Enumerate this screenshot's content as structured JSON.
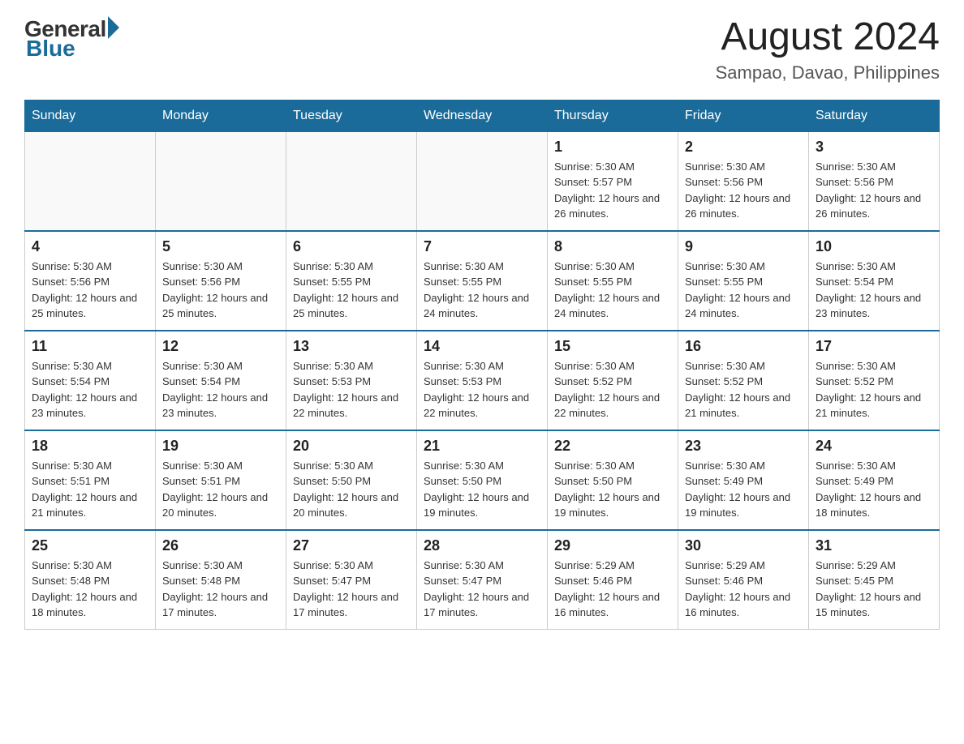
{
  "logo": {
    "general": "General",
    "blue": "Blue"
  },
  "title": {
    "month_year": "August 2024",
    "location": "Sampao, Davao, Philippines"
  },
  "days_header": [
    "Sunday",
    "Monday",
    "Tuesday",
    "Wednesday",
    "Thursday",
    "Friday",
    "Saturday"
  ],
  "weeks": [
    [
      {
        "day": "",
        "info": ""
      },
      {
        "day": "",
        "info": ""
      },
      {
        "day": "",
        "info": ""
      },
      {
        "day": "",
        "info": ""
      },
      {
        "day": "1",
        "info": "Sunrise: 5:30 AM\nSunset: 5:57 PM\nDaylight: 12 hours and 26 minutes."
      },
      {
        "day": "2",
        "info": "Sunrise: 5:30 AM\nSunset: 5:56 PM\nDaylight: 12 hours and 26 minutes."
      },
      {
        "day": "3",
        "info": "Sunrise: 5:30 AM\nSunset: 5:56 PM\nDaylight: 12 hours and 26 minutes."
      }
    ],
    [
      {
        "day": "4",
        "info": "Sunrise: 5:30 AM\nSunset: 5:56 PM\nDaylight: 12 hours and 25 minutes."
      },
      {
        "day": "5",
        "info": "Sunrise: 5:30 AM\nSunset: 5:56 PM\nDaylight: 12 hours and 25 minutes."
      },
      {
        "day": "6",
        "info": "Sunrise: 5:30 AM\nSunset: 5:55 PM\nDaylight: 12 hours and 25 minutes."
      },
      {
        "day": "7",
        "info": "Sunrise: 5:30 AM\nSunset: 5:55 PM\nDaylight: 12 hours and 24 minutes."
      },
      {
        "day": "8",
        "info": "Sunrise: 5:30 AM\nSunset: 5:55 PM\nDaylight: 12 hours and 24 minutes."
      },
      {
        "day": "9",
        "info": "Sunrise: 5:30 AM\nSunset: 5:55 PM\nDaylight: 12 hours and 24 minutes."
      },
      {
        "day": "10",
        "info": "Sunrise: 5:30 AM\nSunset: 5:54 PM\nDaylight: 12 hours and 23 minutes."
      }
    ],
    [
      {
        "day": "11",
        "info": "Sunrise: 5:30 AM\nSunset: 5:54 PM\nDaylight: 12 hours and 23 minutes."
      },
      {
        "day": "12",
        "info": "Sunrise: 5:30 AM\nSunset: 5:54 PM\nDaylight: 12 hours and 23 minutes."
      },
      {
        "day": "13",
        "info": "Sunrise: 5:30 AM\nSunset: 5:53 PM\nDaylight: 12 hours and 22 minutes."
      },
      {
        "day": "14",
        "info": "Sunrise: 5:30 AM\nSunset: 5:53 PM\nDaylight: 12 hours and 22 minutes."
      },
      {
        "day": "15",
        "info": "Sunrise: 5:30 AM\nSunset: 5:52 PM\nDaylight: 12 hours and 22 minutes."
      },
      {
        "day": "16",
        "info": "Sunrise: 5:30 AM\nSunset: 5:52 PM\nDaylight: 12 hours and 21 minutes."
      },
      {
        "day": "17",
        "info": "Sunrise: 5:30 AM\nSunset: 5:52 PM\nDaylight: 12 hours and 21 minutes."
      }
    ],
    [
      {
        "day": "18",
        "info": "Sunrise: 5:30 AM\nSunset: 5:51 PM\nDaylight: 12 hours and 21 minutes."
      },
      {
        "day": "19",
        "info": "Sunrise: 5:30 AM\nSunset: 5:51 PM\nDaylight: 12 hours and 20 minutes."
      },
      {
        "day": "20",
        "info": "Sunrise: 5:30 AM\nSunset: 5:50 PM\nDaylight: 12 hours and 20 minutes."
      },
      {
        "day": "21",
        "info": "Sunrise: 5:30 AM\nSunset: 5:50 PM\nDaylight: 12 hours and 19 minutes."
      },
      {
        "day": "22",
        "info": "Sunrise: 5:30 AM\nSunset: 5:50 PM\nDaylight: 12 hours and 19 minutes."
      },
      {
        "day": "23",
        "info": "Sunrise: 5:30 AM\nSunset: 5:49 PM\nDaylight: 12 hours and 19 minutes."
      },
      {
        "day": "24",
        "info": "Sunrise: 5:30 AM\nSunset: 5:49 PM\nDaylight: 12 hours and 18 minutes."
      }
    ],
    [
      {
        "day": "25",
        "info": "Sunrise: 5:30 AM\nSunset: 5:48 PM\nDaylight: 12 hours and 18 minutes."
      },
      {
        "day": "26",
        "info": "Sunrise: 5:30 AM\nSunset: 5:48 PM\nDaylight: 12 hours and 17 minutes."
      },
      {
        "day": "27",
        "info": "Sunrise: 5:30 AM\nSunset: 5:47 PM\nDaylight: 12 hours and 17 minutes."
      },
      {
        "day": "28",
        "info": "Sunrise: 5:30 AM\nSunset: 5:47 PM\nDaylight: 12 hours and 17 minutes."
      },
      {
        "day": "29",
        "info": "Sunrise: 5:29 AM\nSunset: 5:46 PM\nDaylight: 12 hours and 16 minutes."
      },
      {
        "day": "30",
        "info": "Sunrise: 5:29 AM\nSunset: 5:46 PM\nDaylight: 12 hours and 16 minutes."
      },
      {
        "day": "31",
        "info": "Sunrise: 5:29 AM\nSunset: 5:45 PM\nDaylight: 12 hours and 15 minutes."
      }
    ]
  ]
}
